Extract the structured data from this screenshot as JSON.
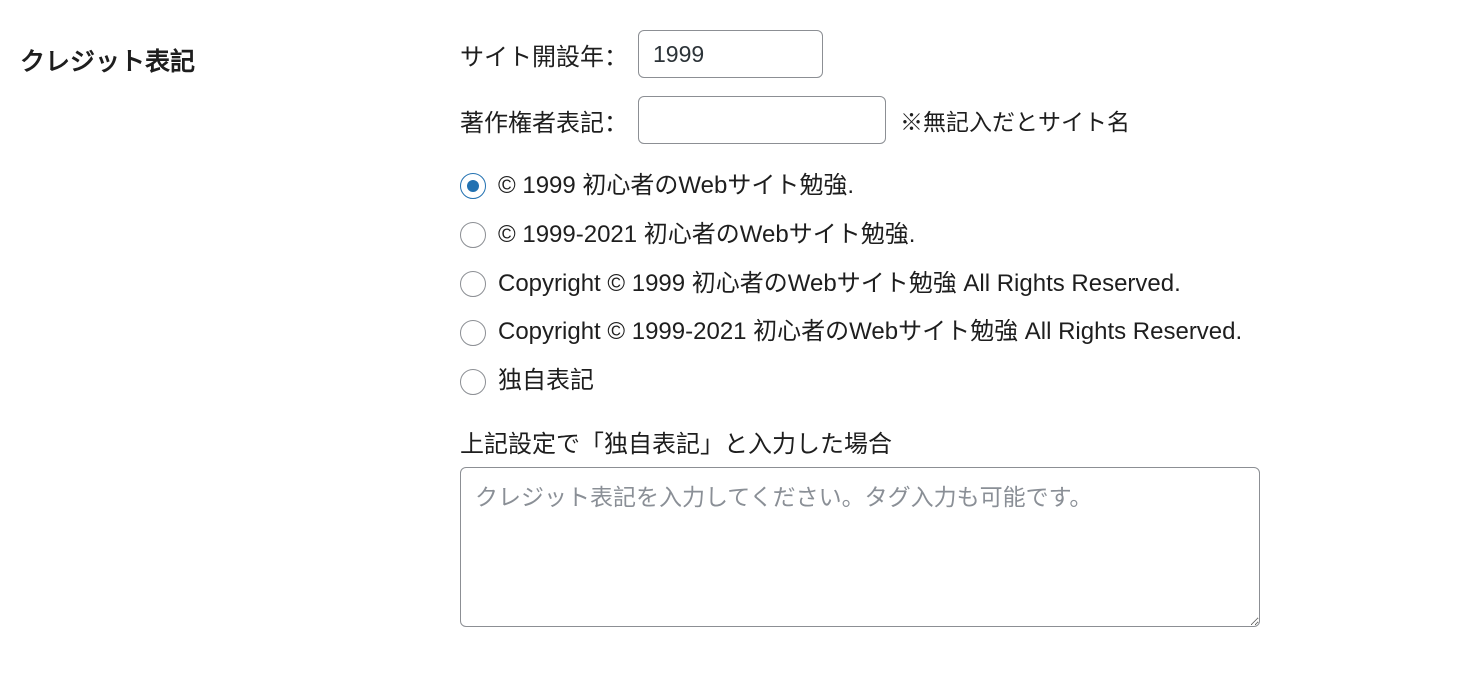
{
  "section": {
    "title": "クレジット表記"
  },
  "fields": {
    "year": {
      "label": "サイト開設年：",
      "value": "1999"
    },
    "author": {
      "label": "著作権者表記：",
      "value": "",
      "note": "※無記入だとサイト名"
    }
  },
  "radios": {
    "selected": 0,
    "options": [
      "© 1999 初心者のWebサイト勉強.",
      "© 1999-2021 初心者のWebサイト勉強.",
      "Copyright © 1999 初心者のWebサイト勉強 All Rights Reserved.",
      "Copyright © 1999-2021 初心者のWebサイト勉強 All Rights Reserved.",
      "独自表記"
    ]
  },
  "custom": {
    "label": "上記設定で「独自表記」と入力した場合",
    "placeholder": "クレジット表記を入力してください。タグ入力も可能です。",
    "value": ""
  }
}
